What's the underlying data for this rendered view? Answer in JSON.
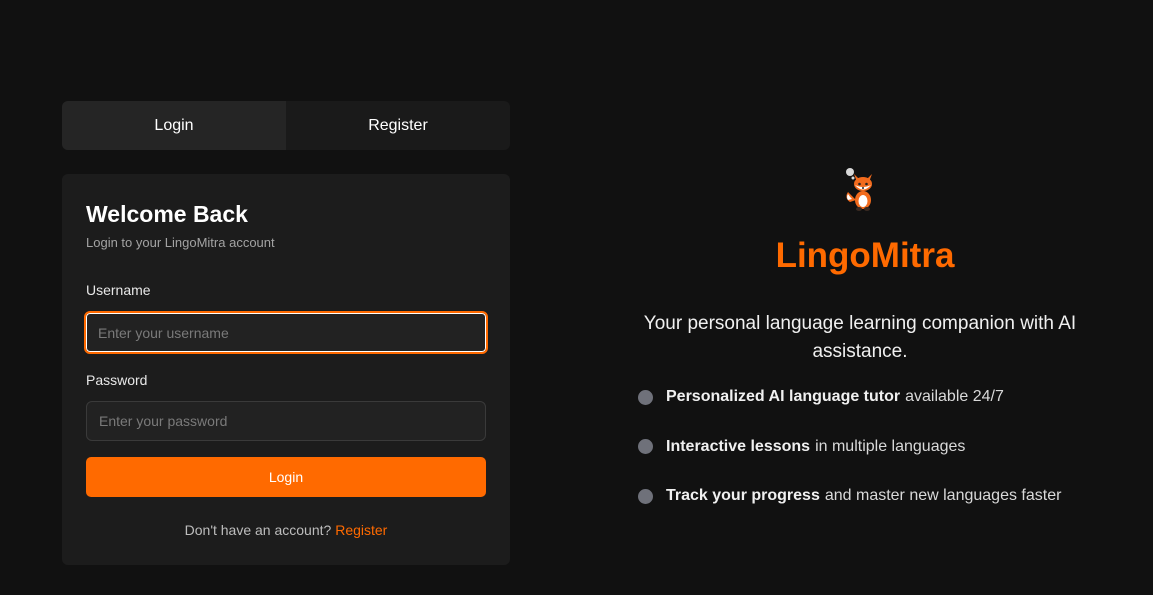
{
  "tabs": {
    "login_label": "Login",
    "register_label": "Register",
    "active": "login"
  },
  "login_card": {
    "title": "Welcome Back",
    "subtitle": "Login to your LingoMitra account",
    "username_label": "Username",
    "username_placeholder": "Enter your username",
    "username_value": "",
    "password_label": "Password",
    "password_placeholder": "Enter your password",
    "password_value": "",
    "submit_label": "Login",
    "signup_prompt": "Don't have an account?",
    "signup_link": "Register"
  },
  "promo": {
    "mascot_icon": "fox-mascot-icon",
    "brand_name": "LingoMitra",
    "tagline": "Your personal language learning companion with AI assistance.",
    "features": [
      {
        "bold": "Personalized AI language tutor",
        "rest": "available 24/7"
      },
      {
        "bold": "Interactive lessons",
        "rest": "in multiple languages"
      },
      {
        "bold": "Track your progress",
        "rest": "and master new languages faster"
      }
    ]
  },
  "colors": {
    "background": "#111111",
    "card": "#1c1c1c",
    "accent": "#ff6a00",
    "bullet": "#6f717a"
  }
}
